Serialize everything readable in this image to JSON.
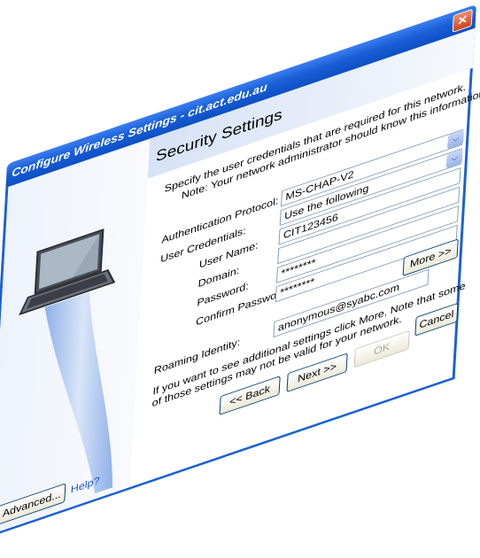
{
  "window": {
    "title": "Configure Wireless Settings - cit.act.edu.au",
    "close_glyph": "✕"
  },
  "page": {
    "heading": "Security Settings",
    "instruction_line1": "Specify the user credentials that are required for this network.",
    "instruction_line2": "Note: Your network administrator should know this information."
  },
  "form": {
    "auth_protocol_label": "Authentication Protocol:",
    "auth_protocol_value": "MS-CHAP-V2",
    "user_credentials_label": "User Credentials:",
    "user_credentials_value": "Use the following",
    "user_name_label": "User Name:",
    "user_name_value": "CIT123456",
    "domain_label": "Domain:",
    "domain_value": "",
    "password_label": "Password:",
    "password_value": "********",
    "confirm_password_label": "Confirm Password:",
    "confirm_password_value": "********",
    "roaming_identity_label": "Roaming Identity:",
    "roaming_identity_value": "anonymous@syabc.com"
  },
  "more_note_line1": "If you want to see additional settings click More. Note that some",
  "more_note_line2": "of those settings may not be valid for your network.",
  "buttons": {
    "more": "More >>",
    "back": "<< Back",
    "next": "Next >>",
    "ok": "OK",
    "cancel": "Cancel",
    "advanced": "Advanced...",
    "help": "Help?"
  },
  "icons": {
    "dropdown_arrow": "⌵",
    "laptop": "laptop-icon",
    "signal": "signal-beam-icon"
  },
  "colors": {
    "title_bar": "#1a5fd6",
    "accent": "#3a7ef0",
    "help_link": "#1a55cc"
  }
}
